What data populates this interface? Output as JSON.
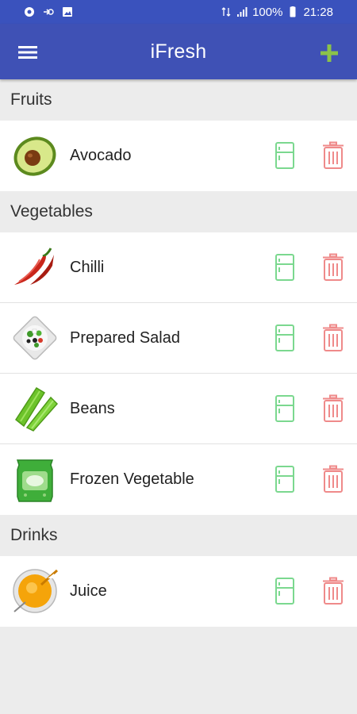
{
  "status_bar": {
    "battery": "100%",
    "time": "21:28",
    "background": "#3a52bd"
  },
  "app_bar": {
    "title": "iFresh",
    "background": "#3f51b5",
    "add_color": "#8bc34a"
  },
  "accent": {
    "fridge": "#7bd88f",
    "trash": "#ef8a8a"
  },
  "sections": [
    {
      "title": "Fruits",
      "items": [
        {
          "name": "Avocado",
          "icon": "avocado-icon"
        }
      ]
    },
    {
      "title": "Vegetables",
      "items": [
        {
          "name": "Chilli",
          "icon": "chilli-icon"
        },
        {
          "name": "Prepared Salad",
          "icon": "salad-icon"
        },
        {
          "name": "Beans",
          "icon": "beans-icon"
        },
        {
          "name": "Frozen Vegetable",
          "icon": "frozen-vegetable-icon"
        }
      ]
    },
    {
      "title": "Drinks",
      "items": [
        {
          "name": "Juice",
          "icon": "juice-icon"
        }
      ]
    }
  ]
}
